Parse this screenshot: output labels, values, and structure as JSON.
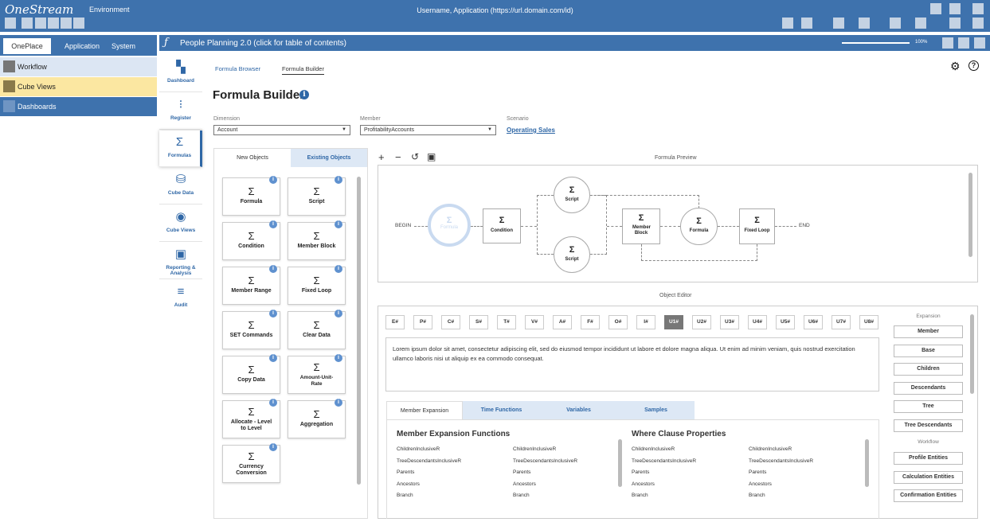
{
  "topbar": {
    "logo": "OneStream",
    "environment": "Environment",
    "user_app": "Username, Application (https://url.domain.com/id)"
  },
  "nav": {
    "tabs": [
      "OnePlace",
      "Application",
      "System"
    ],
    "items": [
      {
        "label": "Workflow",
        "bg": "#dce6f3",
        "icon_color": "#777777",
        "text_color": "#222222"
      },
      {
        "label": "Cube Views",
        "bg": "#fbe7a1",
        "icon_color": "#8a7a4a",
        "text_color": "#222222"
      },
      {
        "label": "Dashboards",
        "bg": "#3e72ad",
        "icon_color": "#6f95c3",
        "text_color": "#ffffff"
      }
    ]
  },
  "app": {
    "title": "People Planning 2.0 (click for table of contents)",
    "zoom": "100%"
  },
  "rail": [
    {
      "label": "Dashboard",
      "icon": "dashboard-icon",
      "glyph": "▚"
    },
    {
      "label": "Register",
      "icon": "register-icon",
      "glyph": "⁝"
    },
    {
      "label": "Formulas",
      "icon": "sigma-icon",
      "glyph": "Σ"
    },
    {
      "label": "Cube Data",
      "icon": "database-icon",
      "glyph": "⛁"
    },
    {
      "label": "Cube Views",
      "icon": "eye-icon",
      "glyph": "◉"
    },
    {
      "label": "Reporting & Analysis",
      "icon": "chart-icon",
      "glyph": "▣"
    },
    {
      "label": "Audit",
      "icon": "audit-icon",
      "glyph": "≡"
    }
  ],
  "main": {
    "tabs": [
      "Formula Browser",
      "Formula Builder"
    ],
    "title": "Formula Builder",
    "dimension": {
      "label": "Dimension",
      "value": "Account"
    },
    "member": {
      "label": "Member",
      "value": "ProfitabilityAccounts"
    },
    "scenario": {
      "label": "Scenario",
      "value": "Operating Sales"
    }
  },
  "objects": {
    "tabs": [
      "New Objects",
      "Existing Objects"
    ],
    "cards": [
      "Formula",
      "Script",
      "Condition",
      "Member Block",
      "Member Range",
      "Fixed Loop",
      "SET Commands",
      "Clear Data",
      "Copy Data",
      "Amount-Unit-Rate",
      "Allocate - Level to Level",
      "Aggregation",
      "Currency Conversion"
    ]
  },
  "preview": {
    "label": "Formula Preview",
    "begin": "BEGIN",
    "end": "END",
    "nodes": {
      "formula_ghost": "Formula",
      "condition": "Condition",
      "script_top": "Script",
      "script_bottom": "Script",
      "member_block": "Member Block",
      "formula": "Formula",
      "fixed_loop": "Fixed Loop"
    }
  },
  "editor": {
    "label": "Object Editor",
    "tokens": [
      "E#",
      "P#",
      "C#",
      "S#",
      "T#",
      "V#",
      "A#",
      "F#",
      "O#",
      "I#",
      "U1#",
      "U2#",
      "U3#",
      "U4#",
      "U5#",
      "U6#",
      "U7#",
      "U8#"
    ],
    "text": "Lorem ipsum dolor sit amet, consectetur adipiscing elit, sed do eiusmod tempor incididunt ut labore et dolore magna aliqua. Ut enim ad minim veniam, quis nostrud exercitation ullamco laboris nisi ut aliquip ex ea commodo consequat.",
    "tabs": [
      "Member Expansion",
      "Time Functions",
      "Variables",
      "Samples"
    ],
    "member_expansion_title": "Member Expansion Functions",
    "where_clause_title": "Where Clause Properties",
    "col1": [
      "ChildrenInclusiveR",
      "TreeDescendantsInclusiveR",
      "Parents",
      "Ancestors",
      "Branch"
    ],
    "col2": [
      "ChildrenInclusiveR",
      "TreeDescendantsInclusiveR",
      "Parents",
      "Ancestors",
      "Branch"
    ],
    "col3": [
      "ChildrenInclusiveR",
      "TreeDescendantsInclusiveR",
      "Parents",
      "Ancestors",
      "Branch"
    ],
    "col4": [
      "ChildrenInclusiveR",
      "TreeDescendantsInclusiveR",
      "Parents",
      "Ancestors",
      "Branch"
    ],
    "expansion_label": "Expansion",
    "expansion_buttons": [
      "Member",
      "Base",
      "Children",
      "Descendants",
      "Tree",
      "Tree Descendants"
    ],
    "workflow_label": "Workflow",
    "workflow_buttons": [
      "Profile Entities",
      "Calculation Entities",
      "Confirmation Entities"
    ]
  }
}
